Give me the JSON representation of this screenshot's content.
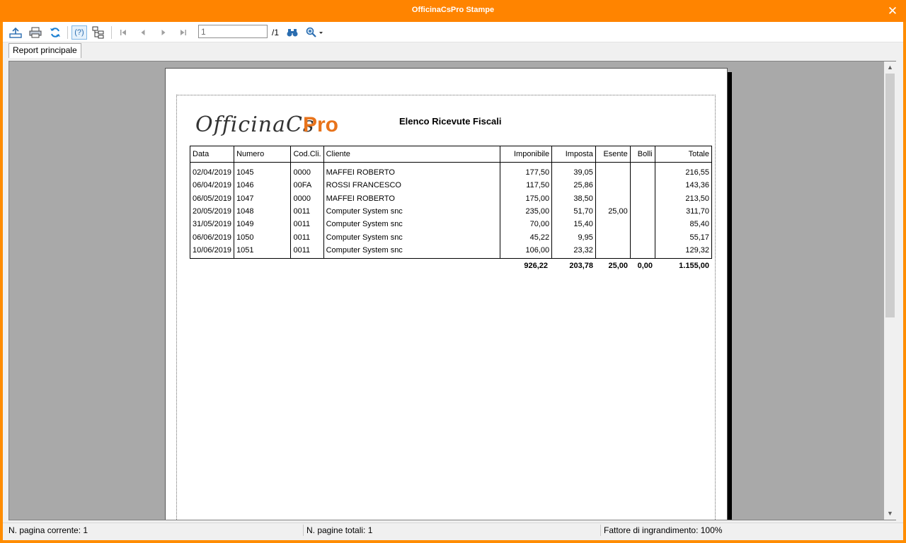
{
  "window": {
    "title": "OfficinaCsPro Stampe",
    "close_label": "✕"
  },
  "toolbar": {
    "export_icon": "export-icon",
    "print_icon": "print-icon",
    "refresh_icon": "refresh-icon",
    "help_label": "(?)",
    "tree_icon": "group-tree-icon",
    "first_icon": "first-page-icon",
    "prev_icon": "previous-page-icon",
    "next_icon": "next-page-icon",
    "last_icon": "last-page-icon",
    "page_value": "1",
    "page_total": "/1",
    "search_icon": "binoculars-icon",
    "zoom_icon": "zoom-icon"
  },
  "tabs": [
    {
      "label": "Report principale"
    }
  ],
  "report": {
    "logo_main": "OfficinaCs",
    "logo_pro": "Pro",
    "title": "Elenco Ricevute Fiscali",
    "columns": [
      "Data",
      "Numero",
      "Cod.Cli.",
      "Cliente",
      "Imponibile",
      "Imposta",
      "Esente",
      "Bolli",
      "Totale"
    ],
    "rows": [
      [
        "02/04/2019",
        "1045",
        "0000",
        "MAFFEI ROBERTO",
        "177,50",
        "39,05",
        "",
        "",
        "216,55"
      ],
      [
        "06/04/2019",
        "1046",
        "00FA",
        "ROSSI FRANCESCO",
        "117,50",
        "25,86",
        "",
        "",
        "143,36"
      ],
      [
        "06/05/2019",
        "1047",
        "0000",
        "MAFFEI ROBERTO",
        "175,00",
        "38,50",
        "",
        "",
        "213,50"
      ],
      [
        "20/05/2019",
        "1048",
        "0011",
        "Computer System snc",
        "235,00",
        "51,70",
        "25,00",
        "",
        "311,70"
      ],
      [
        "31/05/2019",
        "1049",
        "0011",
        "Computer System snc",
        "70,00",
        "15,40",
        "",
        "",
        "85,40"
      ],
      [
        "06/06/2019",
        "1050",
        "0011",
        "Computer System snc",
        "45,22",
        "9,95",
        "",
        "",
        "55,17"
      ],
      [
        "10/06/2019",
        "1051",
        "0011",
        "Computer System snc",
        "106,00",
        "23,32",
        "",
        "",
        "129,32"
      ]
    ],
    "totals": {
      "imponibile": "926,22",
      "imposta": "203,78",
      "esente": "25,00",
      "bolli": "0,00",
      "totale": "1.155,00"
    }
  },
  "status": {
    "current_page": "N. pagina corrente: 1",
    "total_pages": "N. pagine totali: 1",
    "zoom": "Fattore di ingrandimento: 100%"
  },
  "colors": {
    "window_accent": "#ff8400",
    "logo_pro": "#e8731b",
    "viewport_bg": "#a9a9a9"
  }
}
